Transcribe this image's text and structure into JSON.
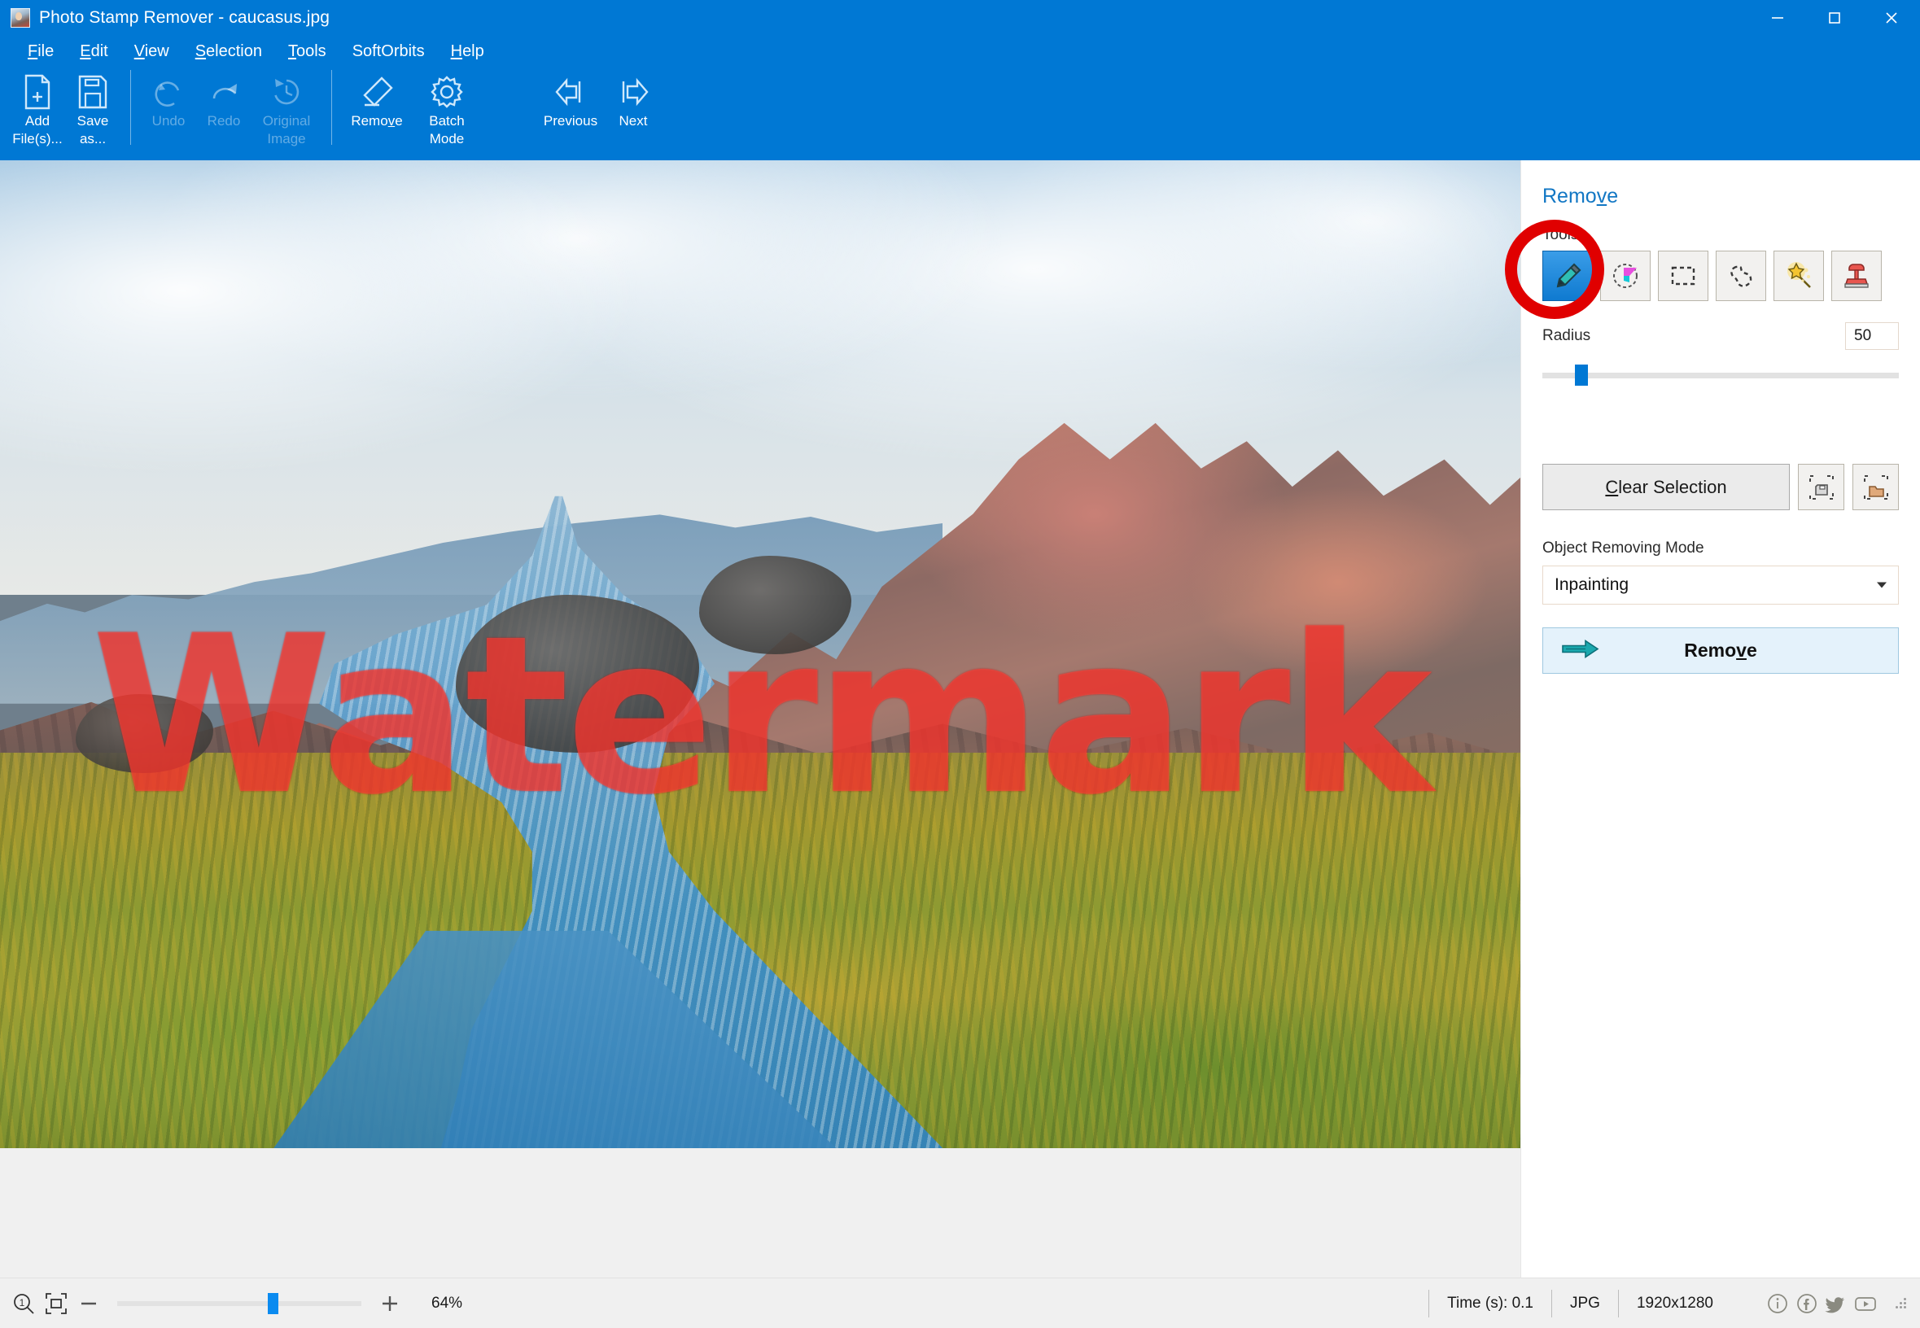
{
  "window": {
    "title": "Photo Stamp Remover - caucasus.jpg",
    "icon": "app-icon",
    "minimize": "minimize-icon",
    "maximize": "maximize-icon",
    "close": "close-icon"
  },
  "menu": {
    "items": [
      {
        "label": "File",
        "accel": "F"
      },
      {
        "label": "Edit",
        "accel": "E"
      },
      {
        "label": "View",
        "accel": "V"
      },
      {
        "label": "Selection",
        "accel": "S"
      },
      {
        "label": "Tools",
        "accel": "T"
      },
      {
        "label": "SoftOrbits",
        "accel": ""
      },
      {
        "label": "Help",
        "accel": "H"
      }
    ]
  },
  "toolbar": {
    "buttons": [
      {
        "id": "add-files",
        "line1": "Add",
        "line2": "File(s)...",
        "icon": "add-file-icon",
        "disabled": false
      },
      {
        "id": "save-as",
        "line1": "Save",
        "line2": "as...",
        "icon": "save-icon",
        "disabled": false
      },
      {
        "id": "undo",
        "line1": "Undo",
        "line2": "",
        "icon": "undo-icon",
        "disabled": true
      },
      {
        "id": "redo",
        "line1": "Redo",
        "line2": "",
        "icon": "redo-icon",
        "disabled": true
      },
      {
        "id": "original-image",
        "line1": "Original",
        "line2": "Image",
        "icon": "history-icon",
        "disabled": true
      },
      {
        "id": "remove",
        "line1": "Remove",
        "line2": "",
        "icon": "eraser-icon",
        "disabled": false
      },
      {
        "id": "batch-mode",
        "line1": "Batch",
        "line2": "Mode",
        "icon": "gear-icon",
        "disabled": false
      },
      {
        "id": "previous",
        "line1": "Previous",
        "line2": "",
        "icon": "previous-arrow-icon",
        "disabled": false
      },
      {
        "id": "next",
        "line1": "Next",
        "line2": "",
        "icon": "next-arrow-icon",
        "disabled": false
      }
    ]
  },
  "canvas": {
    "watermark_text": "Watermark",
    "watermark_color": "#ff463c"
  },
  "panel": {
    "title": "Remove",
    "tools_label": "Tools",
    "tools": [
      {
        "id": "marker",
        "name": "marker-pencil-tool",
        "selected": true
      },
      {
        "id": "highlight",
        "name": "highlighter-tool",
        "selected": false
      },
      {
        "id": "rect",
        "name": "rectangle-select-tool",
        "selected": false
      },
      {
        "id": "lasso",
        "name": "lasso-select-tool",
        "selected": false
      },
      {
        "id": "magicwand",
        "name": "magic-wand-tool",
        "selected": false
      },
      {
        "id": "stamp",
        "name": "clone-stamp-tool",
        "selected": false
      }
    ],
    "radius_label": "Radius",
    "radius_value": "50",
    "clear_selection": "Clear Selection",
    "save_selection_icon": "save-selection-icon",
    "load_selection_icon": "load-selection-icon",
    "mode_label": "Object Removing Mode",
    "mode_value": "Inpainting",
    "remove_button": "Remove",
    "accent_color": "#1277c4",
    "annotation_color": "#e00000"
  },
  "statusbar": {
    "zoom_icon": "zoom-one-to-one-icon",
    "fit_icon": "fit-to-window-icon",
    "minus": "−",
    "plus": "+",
    "zoom_percent": "64%",
    "time": "Time (s): 0.1",
    "format": "JPG",
    "dimensions": "1920x1280",
    "social": [
      {
        "id": "info",
        "name": "info-icon"
      },
      {
        "id": "facebook",
        "name": "facebook-icon"
      },
      {
        "id": "twitter",
        "name": "twitter-icon"
      },
      {
        "id": "youtube",
        "name": "youtube-icon"
      }
    ]
  }
}
